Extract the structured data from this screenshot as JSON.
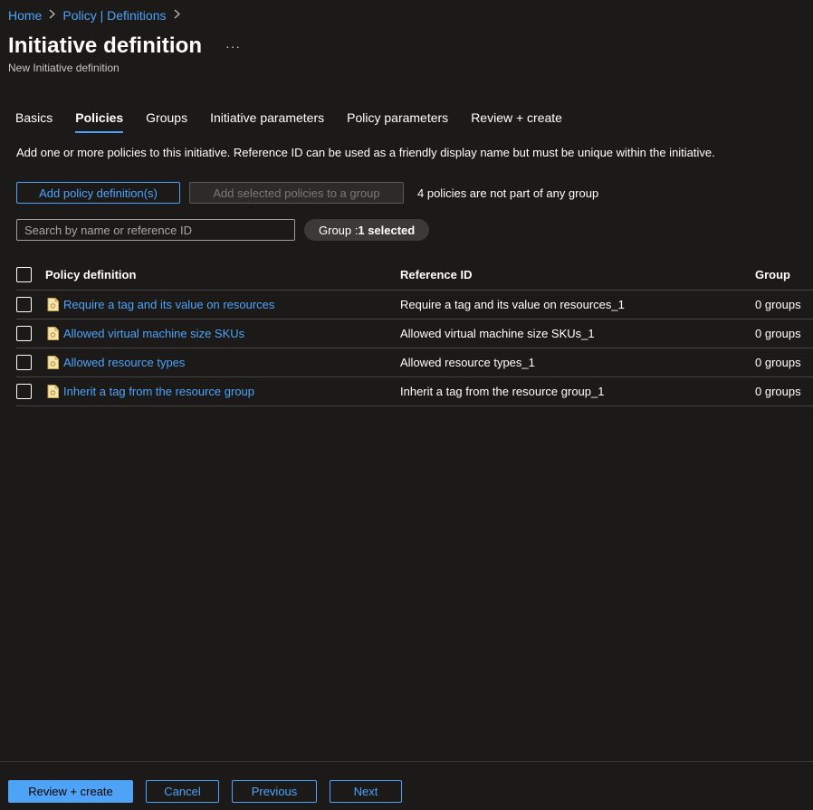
{
  "breadcrumb": [
    {
      "label": "Home"
    },
    {
      "label": "Policy | Definitions"
    }
  ],
  "header": {
    "title": "Initiative definition",
    "more_label": "···",
    "subtitle": "New Initiative definition"
  },
  "tabs": [
    {
      "label": "Basics",
      "active": false
    },
    {
      "label": "Policies",
      "active": true
    },
    {
      "label": "Groups",
      "active": false
    },
    {
      "label": "Initiative parameters",
      "active": false
    },
    {
      "label": "Policy parameters",
      "active": false
    },
    {
      "label": "Review + create",
      "active": false
    }
  ],
  "description": "Add one or more policies to this initiative. Reference ID can be used as a friendly display name but must be unique within the initiative.",
  "actions": {
    "add_policy_label": "Add policy definition(s)",
    "add_to_group_label": "Add selected policies to a group",
    "info": "4 policies are not part of any group"
  },
  "filters": {
    "search_placeholder": "Search by name or reference ID",
    "group_label": "Group : ",
    "group_value": "1 selected"
  },
  "table": {
    "headers": {
      "name": "Policy definition",
      "ref": "Reference ID",
      "group": "Group"
    },
    "rows": [
      {
        "name": "Require a tag and its value on resources",
        "ref": "Require a tag and its value on resources_1",
        "group": "0 groups"
      },
      {
        "name": "Allowed virtual machine size SKUs",
        "ref": "Allowed virtual machine size SKUs_1",
        "group": "0 groups"
      },
      {
        "name": "Allowed resource types",
        "ref": "Allowed resource types_1",
        "group": "0 groups"
      },
      {
        "name": "Inherit a tag from the resource group",
        "ref": "Inherit a tag from the resource group_1",
        "group": "0 groups"
      }
    ]
  },
  "footer": {
    "review_label": "Review + create",
    "cancel_label": "Cancel",
    "previous_label": "Previous",
    "next_label": "Next"
  },
  "colors": {
    "background": "#1b1a19",
    "accent": "#4fa3f7",
    "border": "#484644"
  },
  "icons": {
    "breadcrumb_separator": "chevron-right-icon",
    "policy_row": "policy-definition-icon"
  }
}
